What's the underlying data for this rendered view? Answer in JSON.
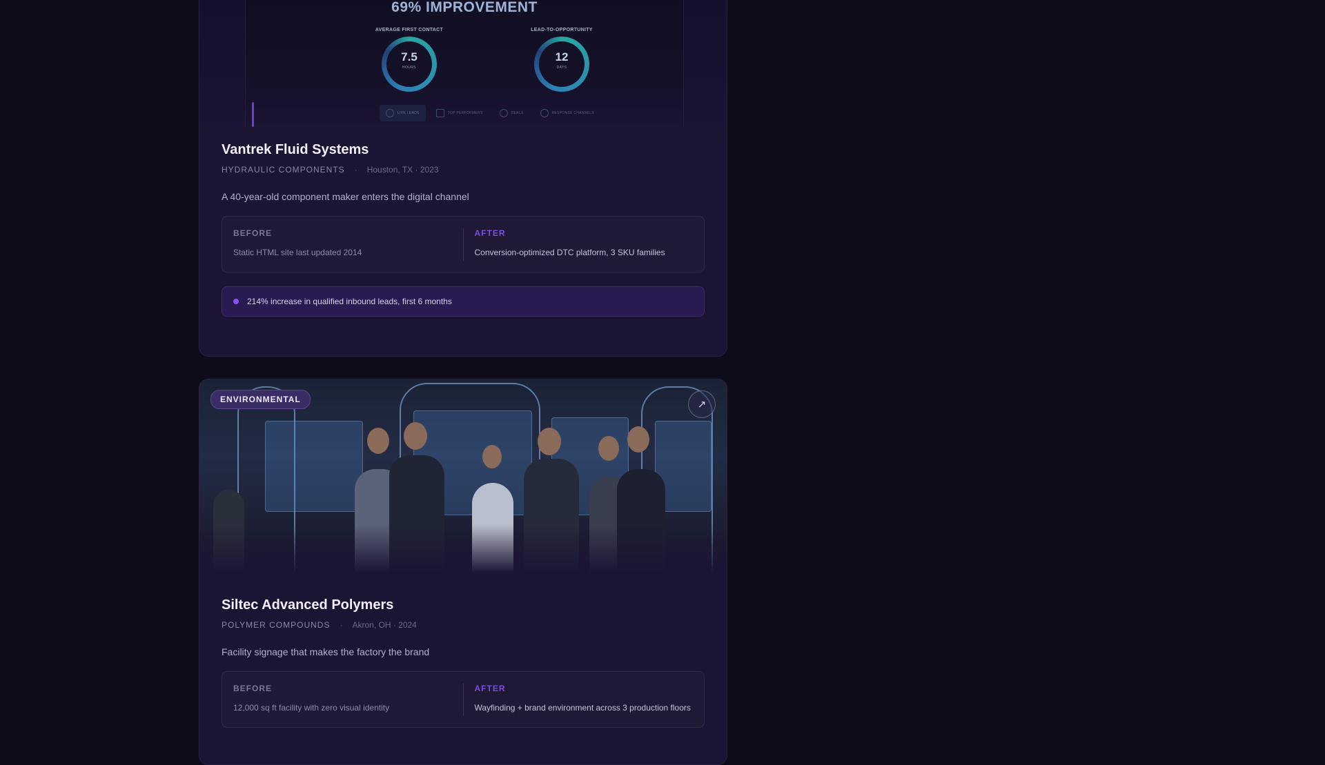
{
  "cards": [
    {
      "hero": {
        "headline": "69% IMPROVEMENT",
        "metrics": [
          {
            "label": "AVERAGE FIRST CONTACT",
            "value": "7.5",
            "unit": "HOURS"
          },
          {
            "label": "LEAD-TO-OPPORTUNITY",
            "value": "12",
            "unit": "DAYS"
          }
        ],
        "tabs": [
          "LIVE LEADS",
          "TOP PERFORMERS",
          "DEALS",
          "RESPONSE CHANNELS"
        ]
      },
      "title": "Vantrek Fluid Systems",
      "industry": "HYDRAULIC COMPONENTS",
      "separator": "·",
      "location": "Houston, TX · 2023",
      "tagline": "A 40-year-old component maker enters the digital channel",
      "before_label": "BEFORE",
      "before_text": "Static HTML site last updated 2014",
      "after_label": "AFTER",
      "after_text": "Conversion-optimized DTC platform, 3 SKU families",
      "result": "214% increase in qualified inbound leads, first 6 months"
    },
    {
      "badge": "ENVIRONMENTAL",
      "title": "Siltec Advanced Polymers",
      "industry": "POLYMER COMPOUNDS",
      "separator": "·",
      "location": "Akron, OH · 2024",
      "tagline": "Facility signage that makes the factory the brand",
      "before_label": "BEFORE",
      "before_text": "12,000 sq ft facility with zero visual identity",
      "after_label": "AFTER",
      "after_text": "Wayfinding + brand environment across 3 production floors"
    }
  ],
  "icons": {
    "open": "arrow-up-right-icon"
  },
  "colors": {
    "background": "#0e0c1b",
    "card": "#1c1434",
    "accent": "#7a4ee0",
    "result_dot": "#8a52f0"
  }
}
